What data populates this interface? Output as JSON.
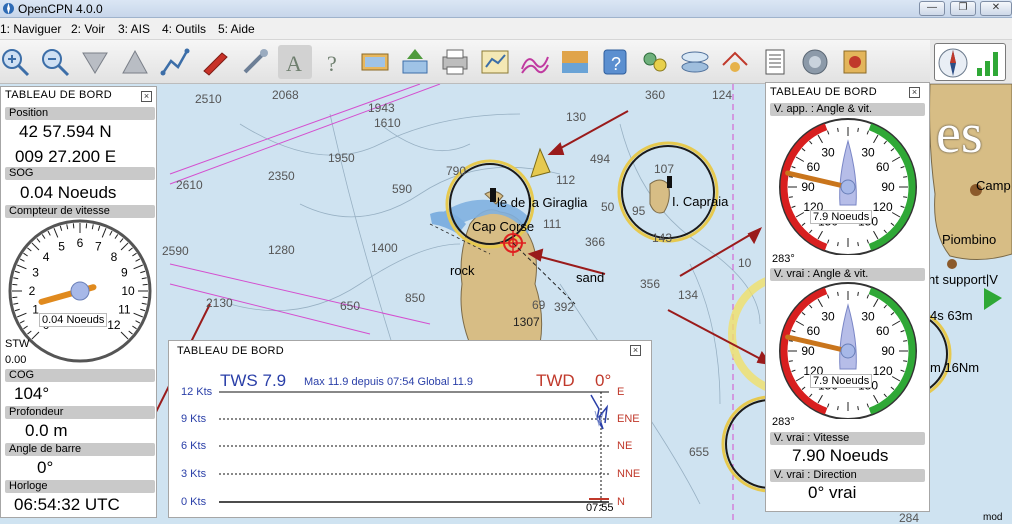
{
  "window": {
    "title": "OpenCPN 4.0.0",
    "minimize": "—",
    "maximize": "❐",
    "close": "✕"
  },
  "menu": [
    "1: Naviguer",
    "2: Voir",
    "3: AIS",
    "4: Outils",
    "5: Aide"
  ],
  "toolbar": {
    "tools": [
      "zoom-in",
      "zoom-out",
      "scale-down",
      "scale-up",
      "route",
      "ship",
      "settings",
      "text",
      "query",
      "track",
      "layers",
      "print",
      "route-manager",
      "tides",
      "info",
      "tide-station",
      "currents",
      "measure",
      "instruments",
      "notes",
      "ais",
      "maps",
      "gps"
    ]
  },
  "left_panel": {
    "title": "TABLEAU DE BORD",
    "position_label": "Position",
    "lat": "42 57.594 N",
    "lon": "009 27.200 E",
    "sog_label": "SOG",
    "sog": "0.04 Noeuds",
    "speedo_label": "Compteur de vitesse",
    "speedo_ticks": [
      "0",
      "1",
      "2",
      "3",
      "4",
      "5",
      "6",
      "7",
      "8",
      "9",
      "10",
      "11",
      "12"
    ],
    "speedo_value": "0.04 Noeuds",
    "speedo_value_number": 0.04,
    "stw_label": "STW",
    "stw_value": "0.00",
    "cog_label": "COG",
    "cog": "104°",
    "depth_label": "Profondeur",
    "depth": "0.0 m",
    "rudder_label": "Angle de barre",
    "rudder": "0°",
    "clock_label": "Horloge",
    "clock": "06:54:32 UTC"
  },
  "right_panel": {
    "title": "TABLEAU DE BORD",
    "app_wind_label": "V. app. : Angle & vit.",
    "app_wind_ticks": [
      "30",
      "30",
      "60",
      "60",
      "90",
      "90",
      "120",
      "120",
      "150",
      "150"
    ],
    "app_wind_value": "7.9 Noeuds",
    "app_wind_dir": "283°",
    "true_wind_label": "V. vrai : Angle & vit.",
    "true_wind_ticks": [
      "30",
      "30",
      "60",
      "60",
      "90",
      "90",
      "120",
      "120",
      "150",
      "150"
    ],
    "true_wind_value": "7.9 Noeuds",
    "true_wind_dir": "283°",
    "true_speed_label": "V. vrai : Vitesse",
    "true_speed": "7.90 Noeuds",
    "true_dir_label": "V. vrai : Direction",
    "true_dir": "0° vrai"
  },
  "wind_history": {
    "title": "TABLEAU DE BORD",
    "tws_label": "TWS 7.9",
    "tws_stats": "Max 11.9 depuis   07:54 Global 11.9",
    "twd_label": "TWD",
    "twd_value": "0°",
    "speed_ticks": [
      "12 Kts",
      "9 Kts",
      "6 Kts",
      "3 Kts",
      "0 Kts"
    ],
    "dir_ticks": [
      "E",
      "ENE",
      "NE",
      "NNE",
      "N"
    ],
    "time_label": "07:55"
  },
  "chart": {
    "depths": [
      {
        "t": "2510"
      },
      {
        "t": "2068"
      },
      {
        "t": "1943"
      },
      {
        "t": "1610"
      },
      {
        "t": "1950"
      },
      {
        "t": "2350"
      },
      {
        "t": "2610"
      },
      {
        "t": "590"
      },
      {
        "t": "790"
      },
      {
        "t": "1400"
      },
      {
        "t": "1280"
      },
      {
        "t": "2590"
      },
      {
        "t": "2130"
      },
      {
        "t": "650"
      },
      {
        "t": "850"
      },
      {
        "t": "1307"
      },
      {
        "t": "360"
      },
      {
        "t": "494"
      },
      {
        "t": "112"
      },
      {
        "t": "356"
      },
      {
        "t": "134"
      },
      {
        "t": "366"
      },
      {
        "t": "392"
      },
      {
        "t": "124"
      },
      {
        "t": "107"
      },
      {
        "t": "95"
      },
      {
        "t": "143"
      },
      {
        "t": "50"
      },
      {
        "t": "10"
      },
      {
        "t": "655"
      },
      {
        "t": "284"
      },
      {
        "t": "130"
      },
      {
        "t": "69"
      },
      {
        "t": "111"
      }
    ],
    "labels": {
      "giraglia": "le de la Giraglia",
      "capraia": "I. Capraia",
      "cap_corse": "Cap Corse",
      "rock": "rock",
      "sand": "sand",
      "piombino": "Piombino",
      "camp": "Camp",
      "support": "ht support|V",
      "dist1": "4s 63m",
      "dist2": "m 16Nm",
      "big_text": "es",
      "mod": "mod"
    }
  }
}
